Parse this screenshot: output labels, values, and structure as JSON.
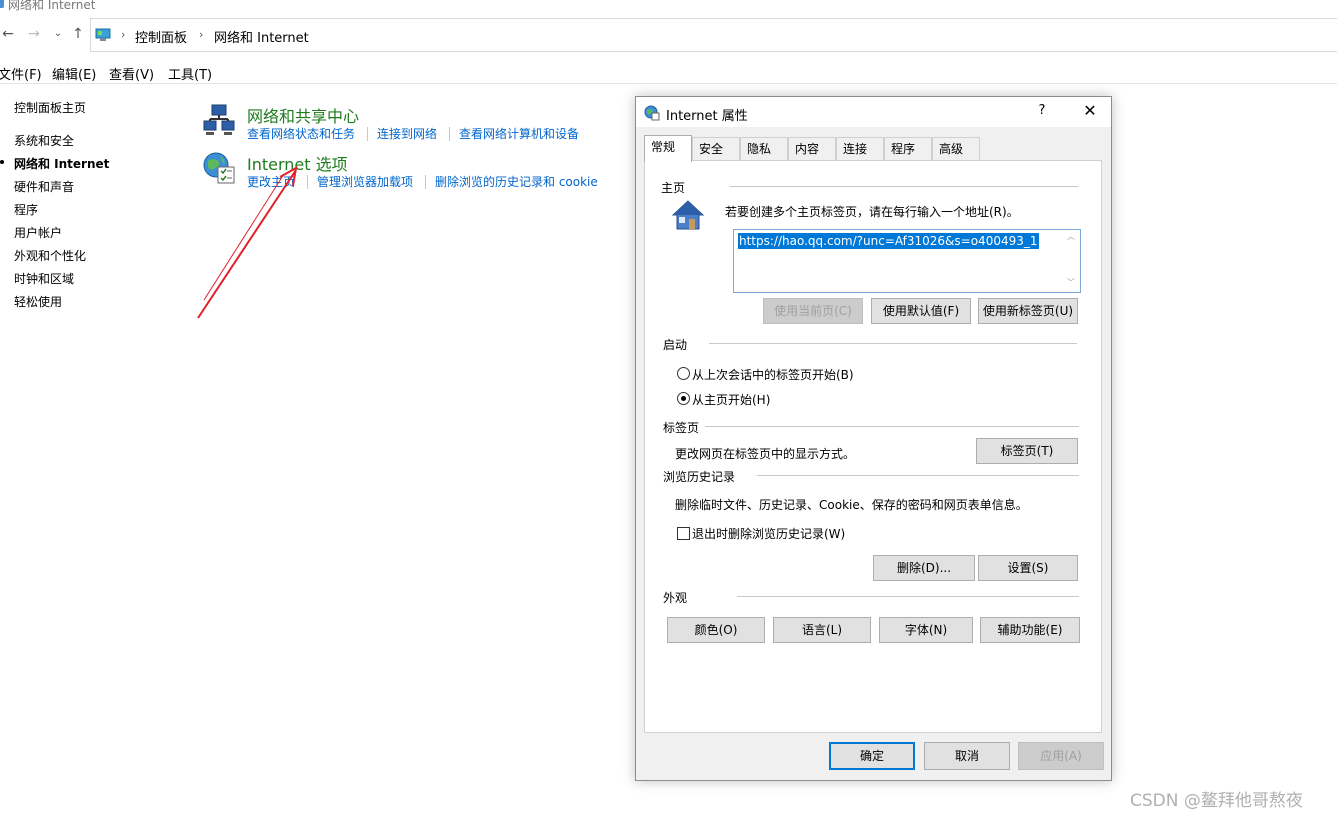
{
  "window": {
    "title": "网络和 Internet"
  },
  "address_bar": {
    "crumbs": [
      "控制面板",
      "网络和 Internet"
    ]
  },
  "menubar": {
    "items": [
      "文件(F)",
      "编辑(E)",
      "查看(V)",
      "工具(T)"
    ]
  },
  "sidebar": {
    "items": [
      {
        "label": "控制面板主页",
        "active": false
      },
      {
        "label": "系统和安全",
        "active": false
      },
      {
        "label": "网络和 Internet",
        "active": true
      },
      {
        "label": "硬件和声音",
        "active": false
      },
      {
        "label": "程序",
        "active": false
      },
      {
        "label": "用户帐户",
        "active": false
      },
      {
        "label": "外观和个性化",
        "active": false
      },
      {
        "label": "时钟和区域",
        "active": false
      },
      {
        "label": "轻松使用",
        "active": false
      }
    ]
  },
  "categories": [
    {
      "title": "网络和共享中心",
      "icon": "network-sharing-icon",
      "links": [
        "查看网络状态和任务",
        "连接到网络",
        "查看网络计算机和设备"
      ]
    },
    {
      "title": "Internet 选项",
      "icon": "internet-options-icon",
      "links": [
        "更改主页",
        "管理浏览器加载项",
        "删除浏览的历史记录和 cookie"
      ]
    }
  ],
  "dialog": {
    "title": "Internet 属性",
    "help": "?",
    "close": "✕",
    "tabs": [
      "常规",
      "安全",
      "隐私",
      "内容",
      "连接",
      "程序",
      "高级"
    ],
    "active_tab": "常规",
    "homepage": {
      "group": "主页",
      "description": "若要创建多个主页标签页，请在每行输入一个地址(R)。",
      "url": "https://hao.qq.com/?unc=Af31026&s=o400493_1",
      "buttons": {
        "use_current": "使用当前页(C)",
        "use_default": "使用默认值(F)",
        "use_new_tab": "使用新标签页(U)"
      }
    },
    "startup": {
      "group": "启动",
      "options": [
        {
          "label": "从上次会话中的标签页开始(B)",
          "checked": false
        },
        {
          "label": "从主页开始(H)",
          "checked": true
        }
      ]
    },
    "tabs_section": {
      "group": "标签页",
      "description": "更改网页在标签页中的显示方式。",
      "button": "标签页(T)"
    },
    "history": {
      "group": "浏览历史记录",
      "description": "删除临时文件、历史记录、Cookie、保存的密码和网页表单信息。",
      "checkbox": "退出时删除浏览历史记录(W)",
      "checkbox_checked": false,
      "delete_button": "删除(D)...",
      "settings_button": "设置(S)"
    },
    "appearance": {
      "group": "外观",
      "buttons": [
        "颜色(O)",
        "语言(L)",
        "字体(N)",
        "辅助功能(E)"
      ]
    },
    "footer": {
      "ok": "确定",
      "cancel": "取消",
      "apply": "应用(A)"
    }
  },
  "watermark": "CSDN @鳌拜他哥熬夜",
  "colors": {
    "category_title": "#1e7b1e",
    "link": "#0066cc",
    "selection": "#0078d7",
    "annotation_arrow": "#e0202a"
  }
}
